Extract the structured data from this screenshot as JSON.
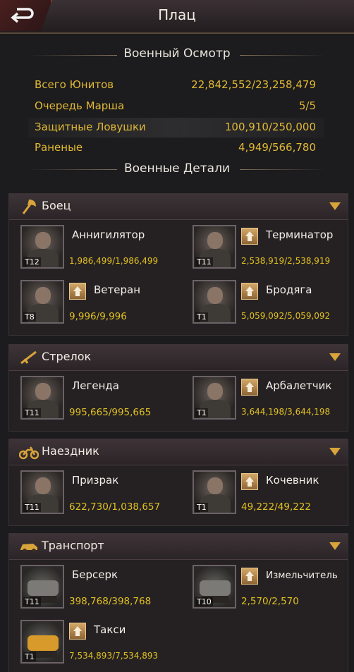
{
  "header": {
    "title": "Плац",
    "back_icon": "back-arrow-icon"
  },
  "review": {
    "title": "Военный Осмотр",
    "stats": [
      {
        "label": "Всего Юнитов",
        "value": "22,842,552/23,258,479"
      },
      {
        "label": "Очередь Марша",
        "value": "5/5"
      },
      {
        "label": "Защитные Ловушки",
        "value": "100,910/250,000"
      },
      {
        "label": "Раненые",
        "value": "4,949/566,780"
      }
    ]
  },
  "details": {
    "title": "Военные Детали"
  },
  "colors": {
    "accent_gold": "#e0c020",
    "stat_gold": "#e0b935",
    "chevron": "#d9a43a"
  },
  "categories": [
    {
      "label": "Боец",
      "icon": "axe-icon",
      "units": [
        {
          "name": "Аннигилятор",
          "tier": "T12",
          "count": "1,986,499/1,986,499",
          "upgrade": false
        },
        {
          "name": "Терминатор",
          "tier": "T11",
          "count": "2,538,919/2,538,919",
          "upgrade": true
        },
        {
          "name": "Ветеран",
          "tier": "T8",
          "count": "9,996/9,996",
          "upgrade": true
        },
        {
          "name": "Бродяга",
          "tier": "T1",
          "count": "5,059,092/5,059,092",
          "upgrade": true
        }
      ]
    },
    {
      "label": "Стрелок",
      "icon": "rifle-icon",
      "units": [
        {
          "name": "Легенда",
          "tier": "T11",
          "count": "995,665/995,665",
          "upgrade": false
        },
        {
          "name": "Арбалетчик",
          "tier": "T1",
          "count": "3,644,198/3,644,198",
          "upgrade": true
        }
      ]
    },
    {
      "label": "Наездник",
      "icon": "motorcycle-icon",
      "units": [
        {
          "name": "Призрак",
          "tier": "T11",
          "count": "622,730/1,038,657",
          "upgrade": false
        },
        {
          "name": "Кочевник",
          "tier": "T1",
          "count": "49,222/49,222",
          "upgrade": true
        }
      ]
    },
    {
      "label": "Транспорт",
      "icon": "car-icon",
      "units": [
        {
          "name": "Берсерк",
          "tier": "T11",
          "count": "398,768/398,768",
          "upgrade": false
        },
        {
          "name": "Измельчитель",
          "tier": "T10",
          "count": "2,570/2,570",
          "upgrade": true
        },
        {
          "name": "Такси",
          "tier": "T1",
          "count": "7,534,893/7,534,893",
          "upgrade": true
        }
      ]
    }
  ]
}
